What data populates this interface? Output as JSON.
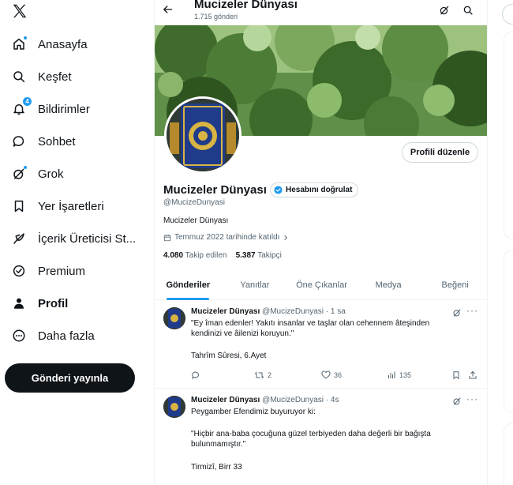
{
  "sidebar": {
    "items": [
      {
        "label": "Anasayfa",
        "icon": "home-icon"
      },
      {
        "label": "Keşfet",
        "icon": "search-icon"
      },
      {
        "label": "Bildirimler",
        "icon": "bell-icon",
        "badge": "4"
      },
      {
        "label": "Sohbet",
        "icon": "chat-icon"
      },
      {
        "label": "Grok",
        "icon": "grok-icon"
      },
      {
        "label": "Yer İşaretleri",
        "icon": "bookmark-icon"
      },
      {
        "label": "İçerik Üreticisi St...",
        "icon": "feather-icon"
      },
      {
        "label": "Premium",
        "icon": "verified-icon"
      },
      {
        "label": "Profil",
        "icon": "person-icon"
      },
      {
        "label": "Daha fazla",
        "icon": "more-icon"
      }
    ],
    "post_button": "Gönderi yayınla"
  },
  "topbar": {
    "name": "Mucizeler Dünyası",
    "post_count": "1.715 gönderi"
  },
  "profile": {
    "edit_button": "Profili düzenle",
    "name": "Mucizeler Dünyası",
    "verify_label": "Hesabını doğrulat",
    "handle": "@MucizeDunyasi",
    "bio": "Mucizeler Dünyası",
    "joined": "Temmuz 2022 tarihinde katıldı",
    "following_count": "4.080",
    "following_label": "Takip edilen",
    "followers_count": "5.387",
    "followers_label": "Takipçi"
  },
  "tabs": [
    "Gönderiler",
    "Yanıtlar",
    "Öne Çıkanlar",
    "Medya",
    "Beğeni"
  ],
  "posts": [
    {
      "name": "Mucizeler Dünyası",
      "handle_time": "@MucizeDunyasi · 1 sa",
      "line1": "\"Ey îman edenler! Yakıtı insanlar ve taşlar olan cehennem âteşinden",
      "line2": "kendinizi ve âilenizi koruyun.\"",
      "line3": "Tahrîm Sûresi, 6.Ayet",
      "retweets": "2",
      "likes": "36",
      "views": "135"
    },
    {
      "name": "Mucizeler Dünyası",
      "handle_time": "@MucizeDunyasi · 4s",
      "line1": "Peygamber Efendimiz buyuruyor ki:",
      "line2": "\"Hiçbir ana-baba çocuğuna güzel terbiyeden daha değerli bir bağışta",
      "line3": "bulunmamıştır.\"",
      "line4": "Tirmizî, Birr 33"
    }
  ]
}
